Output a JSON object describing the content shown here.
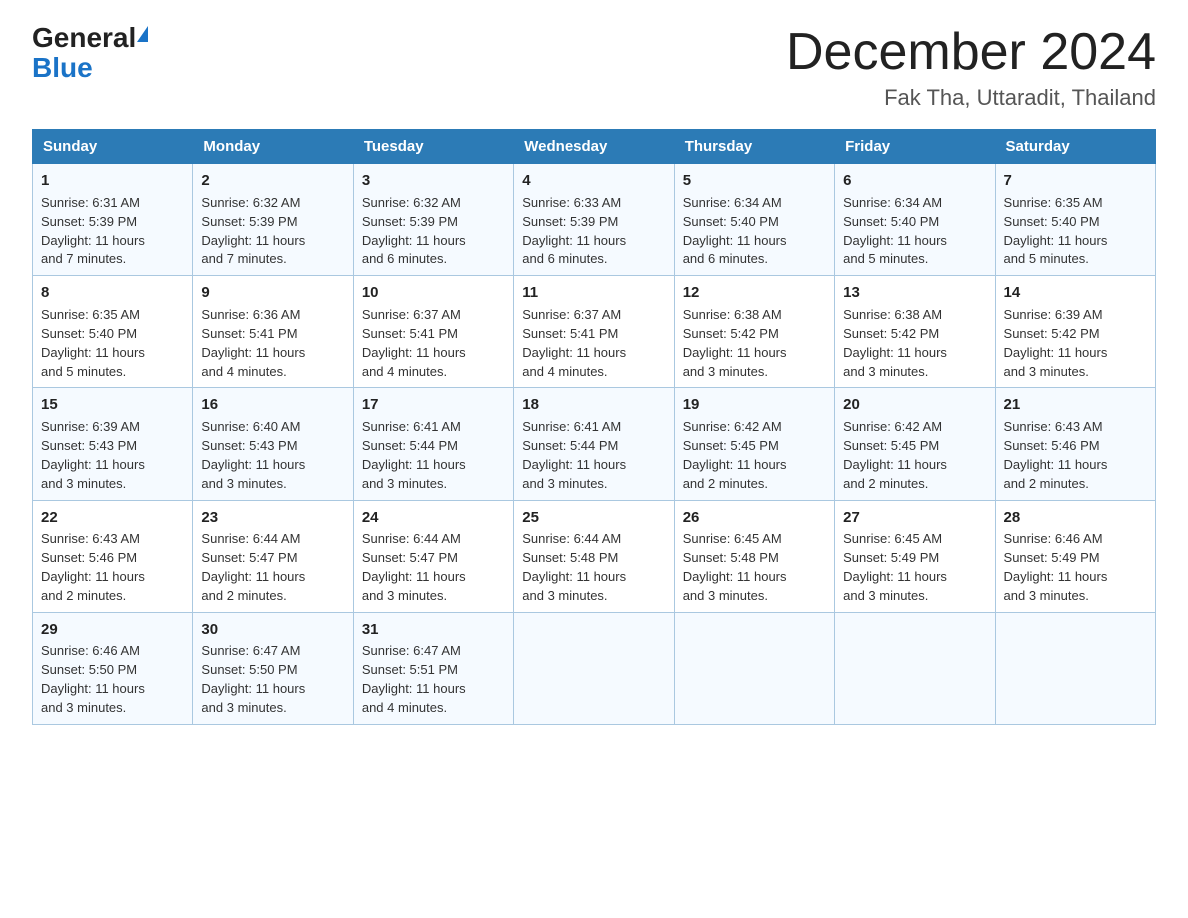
{
  "header": {
    "logo_general": "General",
    "logo_blue": "Blue",
    "month_title": "December 2024",
    "location": "Fak Tha, Uttaradit, Thailand"
  },
  "days_of_week": [
    "Sunday",
    "Monday",
    "Tuesday",
    "Wednesday",
    "Thursday",
    "Friday",
    "Saturday"
  ],
  "weeks": [
    [
      {
        "day": "1",
        "sunrise": "6:31 AM",
        "sunset": "5:39 PM",
        "daylight": "11 hours and 7 minutes."
      },
      {
        "day": "2",
        "sunrise": "6:32 AM",
        "sunset": "5:39 PM",
        "daylight": "11 hours and 7 minutes."
      },
      {
        "day": "3",
        "sunrise": "6:32 AM",
        "sunset": "5:39 PM",
        "daylight": "11 hours and 6 minutes."
      },
      {
        "day": "4",
        "sunrise": "6:33 AM",
        "sunset": "5:39 PM",
        "daylight": "11 hours and 6 minutes."
      },
      {
        "day": "5",
        "sunrise": "6:34 AM",
        "sunset": "5:40 PM",
        "daylight": "11 hours and 6 minutes."
      },
      {
        "day": "6",
        "sunrise": "6:34 AM",
        "sunset": "5:40 PM",
        "daylight": "11 hours and 5 minutes."
      },
      {
        "day": "7",
        "sunrise": "6:35 AM",
        "sunset": "5:40 PM",
        "daylight": "11 hours and 5 minutes."
      }
    ],
    [
      {
        "day": "8",
        "sunrise": "6:35 AM",
        "sunset": "5:40 PM",
        "daylight": "11 hours and 5 minutes."
      },
      {
        "day": "9",
        "sunrise": "6:36 AM",
        "sunset": "5:41 PM",
        "daylight": "11 hours and 4 minutes."
      },
      {
        "day": "10",
        "sunrise": "6:37 AM",
        "sunset": "5:41 PM",
        "daylight": "11 hours and 4 minutes."
      },
      {
        "day": "11",
        "sunrise": "6:37 AM",
        "sunset": "5:41 PM",
        "daylight": "11 hours and 4 minutes."
      },
      {
        "day": "12",
        "sunrise": "6:38 AM",
        "sunset": "5:42 PM",
        "daylight": "11 hours and 3 minutes."
      },
      {
        "day": "13",
        "sunrise": "6:38 AM",
        "sunset": "5:42 PM",
        "daylight": "11 hours and 3 minutes."
      },
      {
        "day": "14",
        "sunrise": "6:39 AM",
        "sunset": "5:42 PM",
        "daylight": "11 hours and 3 minutes."
      }
    ],
    [
      {
        "day": "15",
        "sunrise": "6:39 AM",
        "sunset": "5:43 PM",
        "daylight": "11 hours and 3 minutes."
      },
      {
        "day": "16",
        "sunrise": "6:40 AM",
        "sunset": "5:43 PM",
        "daylight": "11 hours and 3 minutes."
      },
      {
        "day": "17",
        "sunrise": "6:41 AM",
        "sunset": "5:44 PM",
        "daylight": "11 hours and 3 minutes."
      },
      {
        "day": "18",
        "sunrise": "6:41 AM",
        "sunset": "5:44 PM",
        "daylight": "11 hours and 3 minutes."
      },
      {
        "day": "19",
        "sunrise": "6:42 AM",
        "sunset": "5:45 PM",
        "daylight": "11 hours and 2 minutes."
      },
      {
        "day": "20",
        "sunrise": "6:42 AM",
        "sunset": "5:45 PM",
        "daylight": "11 hours and 2 minutes."
      },
      {
        "day": "21",
        "sunrise": "6:43 AM",
        "sunset": "5:46 PM",
        "daylight": "11 hours and 2 minutes."
      }
    ],
    [
      {
        "day": "22",
        "sunrise": "6:43 AM",
        "sunset": "5:46 PM",
        "daylight": "11 hours and 2 minutes."
      },
      {
        "day": "23",
        "sunrise": "6:44 AM",
        "sunset": "5:47 PM",
        "daylight": "11 hours and 2 minutes."
      },
      {
        "day": "24",
        "sunrise": "6:44 AM",
        "sunset": "5:47 PM",
        "daylight": "11 hours and 3 minutes."
      },
      {
        "day": "25",
        "sunrise": "6:44 AM",
        "sunset": "5:48 PM",
        "daylight": "11 hours and 3 minutes."
      },
      {
        "day": "26",
        "sunrise": "6:45 AM",
        "sunset": "5:48 PM",
        "daylight": "11 hours and 3 minutes."
      },
      {
        "day": "27",
        "sunrise": "6:45 AM",
        "sunset": "5:49 PM",
        "daylight": "11 hours and 3 minutes."
      },
      {
        "day": "28",
        "sunrise": "6:46 AM",
        "sunset": "5:49 PM",
        "daylight": "11 hours and 3 minutes."
      }
    ],
    [
      {
        "day": "29",
        "sunrise": "6:46 AM",
        "sunset": "5:50 PM",
        "daylight": "11 hours and 3 minutes."
      },
      {
        "day": "30",
        "sunrise": "6:47 AM",
        "sunset": "5:50 PM",
        "daylight": "11 hours and 3 minutes."
      },
      {
        "day": "31",
        "sunrise": "6:47 AM",
        "sunset": "5:51 PM",
        "daylight": "11 hours and 4 minutes."
      },
      null,
      null,
      null,
      null
    ]
  ],
  "labels": {
    "sunrise": "Sunrise:",
    "sunset": "Sunset:",
    "daylight": "Daylight:"
  }
}
